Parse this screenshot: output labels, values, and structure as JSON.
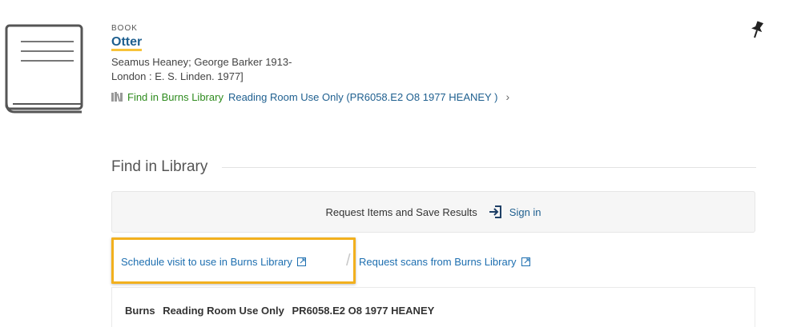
{
  "record": {
    "type": "BOOK",
    "title": "Otter",
    "author": "Seamus Heaney; George Barker 1913-",
    "publication": "London : E. S. Linden. 1977]",
    "availability": {
      "location": "Find in Burns Library",
      "status": "Reading Room Use Only (PR6058.E2 O8 1977 HEANEY )",
      "chevron": "›"
    }
  },
  "find_in_library": {
    "heading": "Find in Library",
    "signin_prompt": "Request Items and Save Results",
    "signin_label": "Sign in"
  },
  "links": {
    "schedule_visit": "Schedule visit to use in Burns Library",
    "separator": "/",
    "request_scans": "Request scans from Burns Library"
  },
  "holding": {
    "library": "Burns",
    "location": "Reading Room Use Only",
    "call_number": "PR6058.E2 O8 1977 HEANEY"
  },
  "colors": {
    "link": "#1e6fb0",
    "available": "#2e8b1e",
    "highlight": "#f2b01e"
  }
}
